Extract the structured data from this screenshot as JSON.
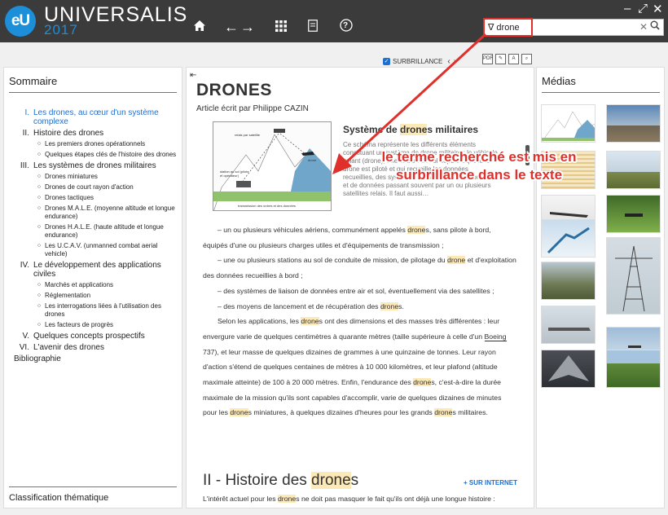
{
  "app": {
    "brand": "UNIVERSALIS",
    "year": "2017",
    "logo": "eU"
  },
  "toolbar": {
    "home_icon": "home-icon",
    "back_label": "←",
    "forward_label": "→",
    "grid_icon": "grid-icon",
    "help_label": "?"
  },
  "window": {
    "minimize": "–",
    "maximize": "⤢",
    "close": "✕"
  },
  "search": {
    "value": "drone",
    "filter_glyph": "∇",
    "clear_glyph": "✕",
    "icon": "search-icon"
  },
  "left": {
    "title": "Sommaire",
    "footer": "Classification thématique",
    "toc": [
      {
        "num": "I.",
        "label": "Les drones, au cœur d'un système complexe",
        "active": true,
        "children": []
      },
      {
        "num": "II.",
        "label": "Histoire des drones",
        "active": false,
        "children": [
          "Les premiers drones opérationnels",
          "Quelques étapes clés de l'histoire des drones"
        ]
      },
      {
        "num": "III.",
        "label": "Les systèmes de drones militaires",
        "active": false,
        "children": [
          "Drones miniatures",
          "Drones de court rayon d'action",
          "Drones tactiques",
          "Drones M.A.L.E. (moyenne altitude et longue endurance)",
          "Drones H.A.L.E. (haute altitude et longue endurance)",
          "Les U.C.A.V. (unmanned combat aerial vehicle)"
        ]
      },
      {
        "num": "IV.",
        "label": "Le développement des applications civiles",
        "active": false,
        "children": [
          "Marchés et applications",
          "Réglementation",
          "Les interrogations liées à l'utilisation des drones",
          "Les facteurs de progrès"
        ]
      },
      {
        "num": "V.",
        "label": "Quelques concepts prospectifs",
        "active": false,
        "children": []
      },
      {
        "num": "VI.",
        "label": "L'avenir des drones",
        "active": false,
        "children": []
      }
    ],
    "bibliography": "Bibliographie"
  },
  "article_toolbar": {
    "highlight_label": "SURBRILLANCE",
    "prev": "‹",
    "next": "›",
    "tools": [
      "PDF",
      "✎",
      "A",
      "⌕"
    ]
  },
  "article": {
    "title": "DRONES",
    "author_prefix": "Article écrit par ",
    "author": "Philippe CAZIN",
    "figure_title_pre": "Système de ",
    "figure_title_hl": "drone",
    "figure_title_post": "s militaires",
    "figure_caption": "Ce schéma représente les différents éléments constituant un système de drone militaire : le véhicule volant (drone), une station au sol depuis laquelle le drone est piloté et qui recueille les données recueillies, des systèmes de transmissions d'ordres et de données passant souvent par un ou plusieurs satellites relais. Il faut aussi…",
    "figure_labels": [
      "relais par satellite",
      "drone",
      "station au sol (pilote et opérateur)",
      "transmission des ordres et des données"
    ],
    "paragraphs": [
      {
        "pre": "– un ou plusieurs véhicules aériens, communément appelés ",
        "hl": "drone",
        "post": "s, sans pilote à bord, équipés d'une ou plusieurs charges utiles et d'équipements de transmission ;"
      },
      {
        "pre": "– une ou plusieurs stations au sol de conduite de mission, de pilotage du ",
        "hl": "drone",
        "post": " et d'exploitation des données recueillies à bord ;"
      },
      {
        "pre": "– des systèmes de liaison de données entre air et sol, éventuellement via des satellites ;",
        "hl": "",
        "post": ""
      },
      {
        "pre": "– des moyens de lancement et de récupération des ",
        "hl": "drone",
        "post": "s."
      }
    ],
    "long_para": {
      "t1": "Selon les applications, les ",
      "h1": "drone",
      "t2": "s ont des dimensions et des masses très différentes : leur envergure varie de quelques centimètres à quarante mètres (taille supérieure à celle d'un ",
      "link": "Boeing",
      "t3": " 737), et leur masse de quelques dizaines de grammes à une quinzaine de tonnes. Leur rayon d'action s'étend de quelques centaines de mètres à 10 000 kilomètres, et leur plafond (altitude maximale atteinte) de 100 à 20 000 mètres. Enfin, l'endurance des ",
      "h2": "drone",
      "t4": "s, c'est-à-dire la durée maximale de la mission qu'ils sont capables d'accomplir, varie de quelques dizaines de minutes pour les ",
      "h3": "drone",
      "t5": "s miniatures, à quelques dizaines d'heures pour les grands ",
      "h4": "drone",
      "t6": "s militaires."
    },
    "section_heading_pre": "II - Histoire des ",
    "section_heading_hl": "drone",
    "section_heading_post": "s",
    "internet_link": "+ SUR INTERNET",
    "last_line_pre": "L'intérêt actuel pour les ",
    "last_line_hl": "drone",
    "last_line_post": "s ne doit pas masquer le fait qu'ils ont déjà une longue histoire :"
  },
  "right": {
    "title": "Médias",
    "thumbnails": [
      "schéma système de drone",
      "paysage aérien",
      "drone sur terrain",
      "tableau de données",
      "drone en vol ciel vert",
      "insecte drone",
      "pylône électrique et drone",
      "avion militaire camouflé",
      "drone sur tarmac",
      "drone dans le ciel",
      "drone furtif",
      "champ agricole"
    ]
  },
  "annotation": {
    "text": "le terme recherché est mis en surbrillance dans le texte"
  },
  "colors": {
    "topbar": "#3b3b3b",
    "accent": "#1d8ed8",
    "highlight": "#fde9b6",
    "annotation": "#e0302b"
  }
}
